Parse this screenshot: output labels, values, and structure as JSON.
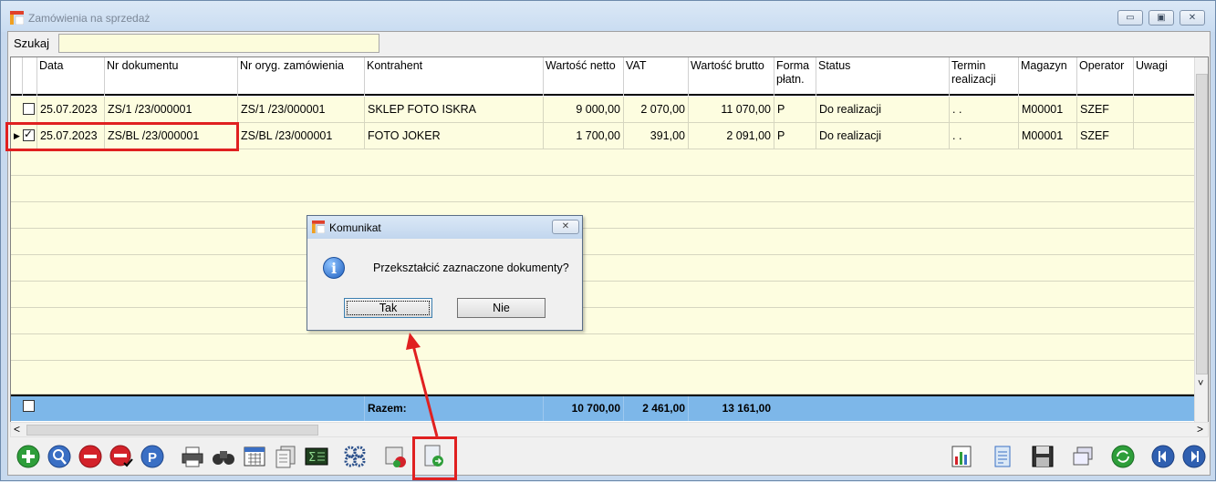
{
  "window": {
    "title": "Zamówienia na sprzedaż",
    "minimize": "▭",
    "maximize": "▣",
    "close": "✕"
  },
  "search": {
    "label": "Szukaj",
    "value": ""
  },
  "columns": [
    "Data",
    "Nr dokumentu",
    "Nr oryg. zamówienia",
    "Kontrahent",
    "Wartość netto",
    "VAT",
    "Wartość brutto",
    "Forma płatn.",
    "Status",
    "Termin realizacji",
    "Magazyn",
    "Operator",
    "Uwagi"
  ],
  "rows": [
    {
      "checked": false,
      "current": false,
      "data": "25.07.2023",
      "nr_dokumentu": "ZS/1  /23/000001",
      "nr_oryg": "ZS/1  /23/000001",
      "kontrahent": "SKLEP FOTO ISKRA",
      "netto": "9 000,00",
      "vat": "2 070,00",
      "brutto": "11 070,00",
      "forma": "P",
      "status": "Do realizacji",
      "termin": ". .",
      "magazyn": "M00001",
      "operator": "SZEF",
      "uwagi": ""
    },
    {
      "checked": true,
      "current": true,
      "data": "25.07.2023",
      "nr_dokumentu": "ZS/BL /23/000001",
      "nr_oryg": "ZS/BL /23/000001",
      "kontrahent": "FOTO JOKER",
      "netto": "1 700,00",
      "vat": "391,00",
      "brutto": "2 091,00",
      "forma": "P",
      "status": "Do realizacji",
      "termin": ". .",
      "magazyn": "M00001",
      "operator": "SZEF",
      "uwagi": ""
    }
  ],
  "summary": {
    "label": "Razem:",
    "netto": "10 700,00",
    "vat": "2 461,00",
    "brutto": "13 161,00"
  },
  "dialog": {
    "title": "Komunikat",
    "message": "Przekształcić zaznaczone dokumenty?",
    "yes": "Tak",
    "no": "Nie",
    "close": "✕",
    "info_glyph": "i"
  },
  "scroll_arrows": {
    "left": "<",
    "right": ">",
    "down": "˅"
  },
  "current_row_marker": "▶",
  "annotation_color": "#e02020"
}
